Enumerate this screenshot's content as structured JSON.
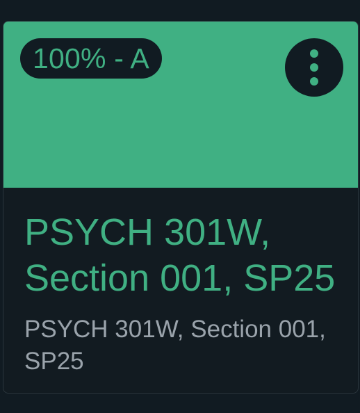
{
  "course_card": {
    "grade_badge": "100% - A",
    "menu_icon": "kebab-menu-icon",
    "title": "PSYCH 301W, Section 001, SP25",
    "subtitle": "PSYCH 301W, Section 001, SP25",
    "colors": {
      "accent": "#40b083",
      "background": "#111b22",
      "subtitle_text": "#9aa3ab"
    }
  }
}
